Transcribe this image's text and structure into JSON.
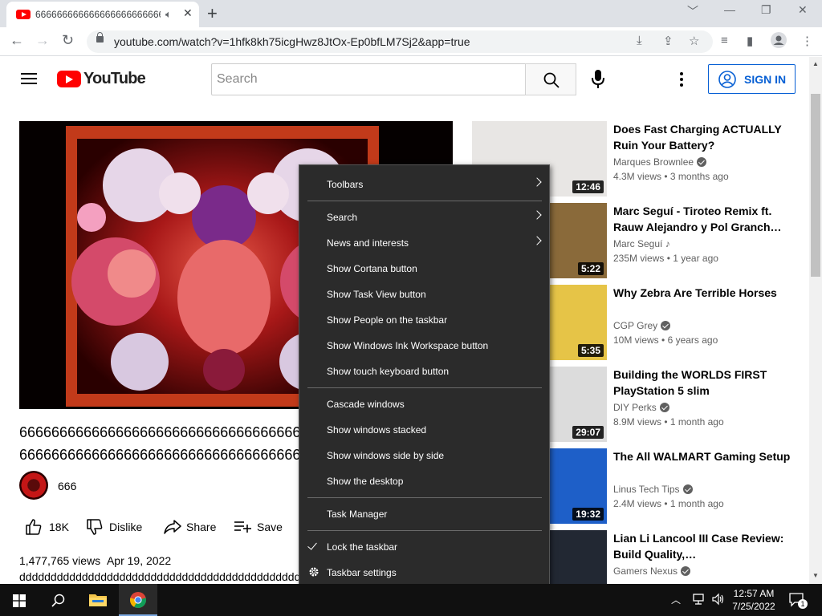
{
  "browser": {
    "tab_title": "6666666666666666666666666666666666666666",
    "url": "youtube.com/watch?v=1hfk8kh75icgHwz8JtOx-Ep0bfLM7Sj2&app=true"
  },
  "youtube": {
    "logo_text": "YouTube",
    "search_placeholder": "Search",
    "signin_label": "SIGN IN"
  },
  "video": {
    "title_line1": "66666666666666666666666666666666666666666666",
    "title_line2": "66666666666666666666666666666666666666666666",
    "channel": "666",
    "likes": "18K",
    "dislike_label": "Dislike",
    "share_label": "Share",
    "save_label": "Save",
    "views": "1,477,765 views",
    "date": "Apr 19, 2022",
    "description": "ddddddddddddddddddddddddddddddddddddddddddddddddddddd"
  },
  "related": [
    {
      "title": "Does Fast Charging ACTUALLY Ruin Your Battery?",
      "channel": "Marques Brownlee",
      "verified": true,
      "music": false,
      "views": "4.3M views",
      "age": "3 months ago",
      "duration": "12:46",
      "thumb_color": "#e8e6e4"
    },
    {
      "title": "Marc Seguí - Tiroteo Remix ft. Rauw Alejandro y Pol Granch…",
      "channel": "Marc Seguí",
      "verified": false,
      "music": true,
      "views": "235M views",
      "age": "1 year ago",
      "duration": "5:22",
      "thumb_color": "#8a6a3a"
    },
    {
      "title": "Why Zebra Are Terrible Horses",
      "channel": "CGP Grey",
      "verified": true,
      "music": false,
      "views": "10M views",
      "age": "6 years ago",
      "duration": "5:35",
      "thumb_color": "#e6c447"
    },
    {
      "title": "Building the WORLDS FIRST PlayStation 5 slim",
      "channel": "DIY Perks",
      "verified": true,
      "music": false,
      "views": "8.9M views",
      "age": "1 month ago",
      "duration": "29:07",
      "thumb_color": "#dcdcdc"
    },
    {
      "title": "The All WALMART Gaming Setup",
      "channel": "Linus Tech Tips",
      "verified": true,
      "music": false,
      "views": "2.4M views",
      "age": "1 month ago",
      "duration": "19:32",
      "thumb_color": "#1e5fc8"
    },
    {
      "title": "Lian Li Lancool III Case Review: Build Quality,…",
      "channel": "Gamers Nexus",
      "verified": true,
      "music": false,
      "views": "",
      "age": "",
      "duration": "",
      "thumb_color": "#222833"
    }
  ],
  "context_menu": {
    "items": [
      {
        "label": "Toolbars",
        "arrow": true
      },
      {
        "label": "Search",
        "arrow": true
      },
      {
        "label": "News and interests",
        "arrow": true
      },
      {
        "label": "Show Cortana button"
      },
      {
        "label": "Show Task View button"
      },
      {
        "label": "Show People on the taskbar"
      },
      {
        "label": "Show Windows Ink Workspace button"
      },
      {
        "label": "Show touch keyboard button"
      },
      {
        "label": "Cascade windows"
      },
      {
        "label": "Show windows stacked"
      },
      {
        "label": "Show windows side by side"
      },
      {
        "label": "Show the desktop"
      },
      {
        "label": "Task Manager"
      },
      {
        "label": "Lock the taskbar",
        "checked": true
      },
      {
        "label": "Taskbar settings",
        "icon": "gear-icon"
      }
    ]
  },
  "taskbar": {
    "time": "12:57 AM",
    "date": "7/25/2022",
    "notification_count": "1"
  },
  "colors": {
    "yt_red": "#ff0000",
    "signin_blue": "#065fd4",
    "menu_bg": "#2b2b2b",
    "taskbar_bg": "#101010"
  }
}
